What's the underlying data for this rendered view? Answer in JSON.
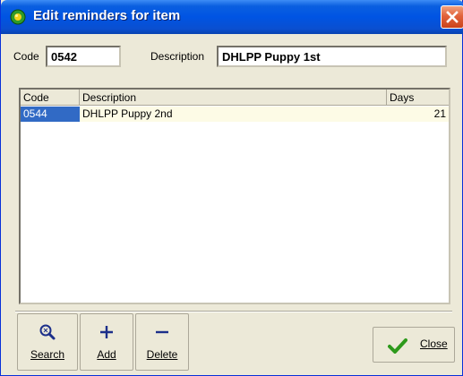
{
  "window": {
    "title": "Edit reminders for item",
    "icon": "app-icon",
    "close_icon": "close-icon"
  },
  "form": {
    "code_label": "Code",
    "code_value": "0542",
    "description_label": "Description",
    "description_value": "DHLPP Puppy 1st"
  },
  "grid": {
    "columns": [
      "Code",
      "Description",
      "Days"
    ],
    "rows": [
      {
        "code": "0544",
        "description": "DHLPP Puppy 2nd",
        "days": "21"
      }
    ],
    "selected_row": 0
  },
  "toolbar": {
    "search_label": "Search",
    "add_label": "Add",
    "delete_label": "Delete",
    "close_label": "Close"
  },
  "colors": {
    "title_bar": "#0054e3",
    "selection": "#316ac5",
    "row_background": "#fdfbe6",
    "close_check": "#2e9a1c"
  }
}
